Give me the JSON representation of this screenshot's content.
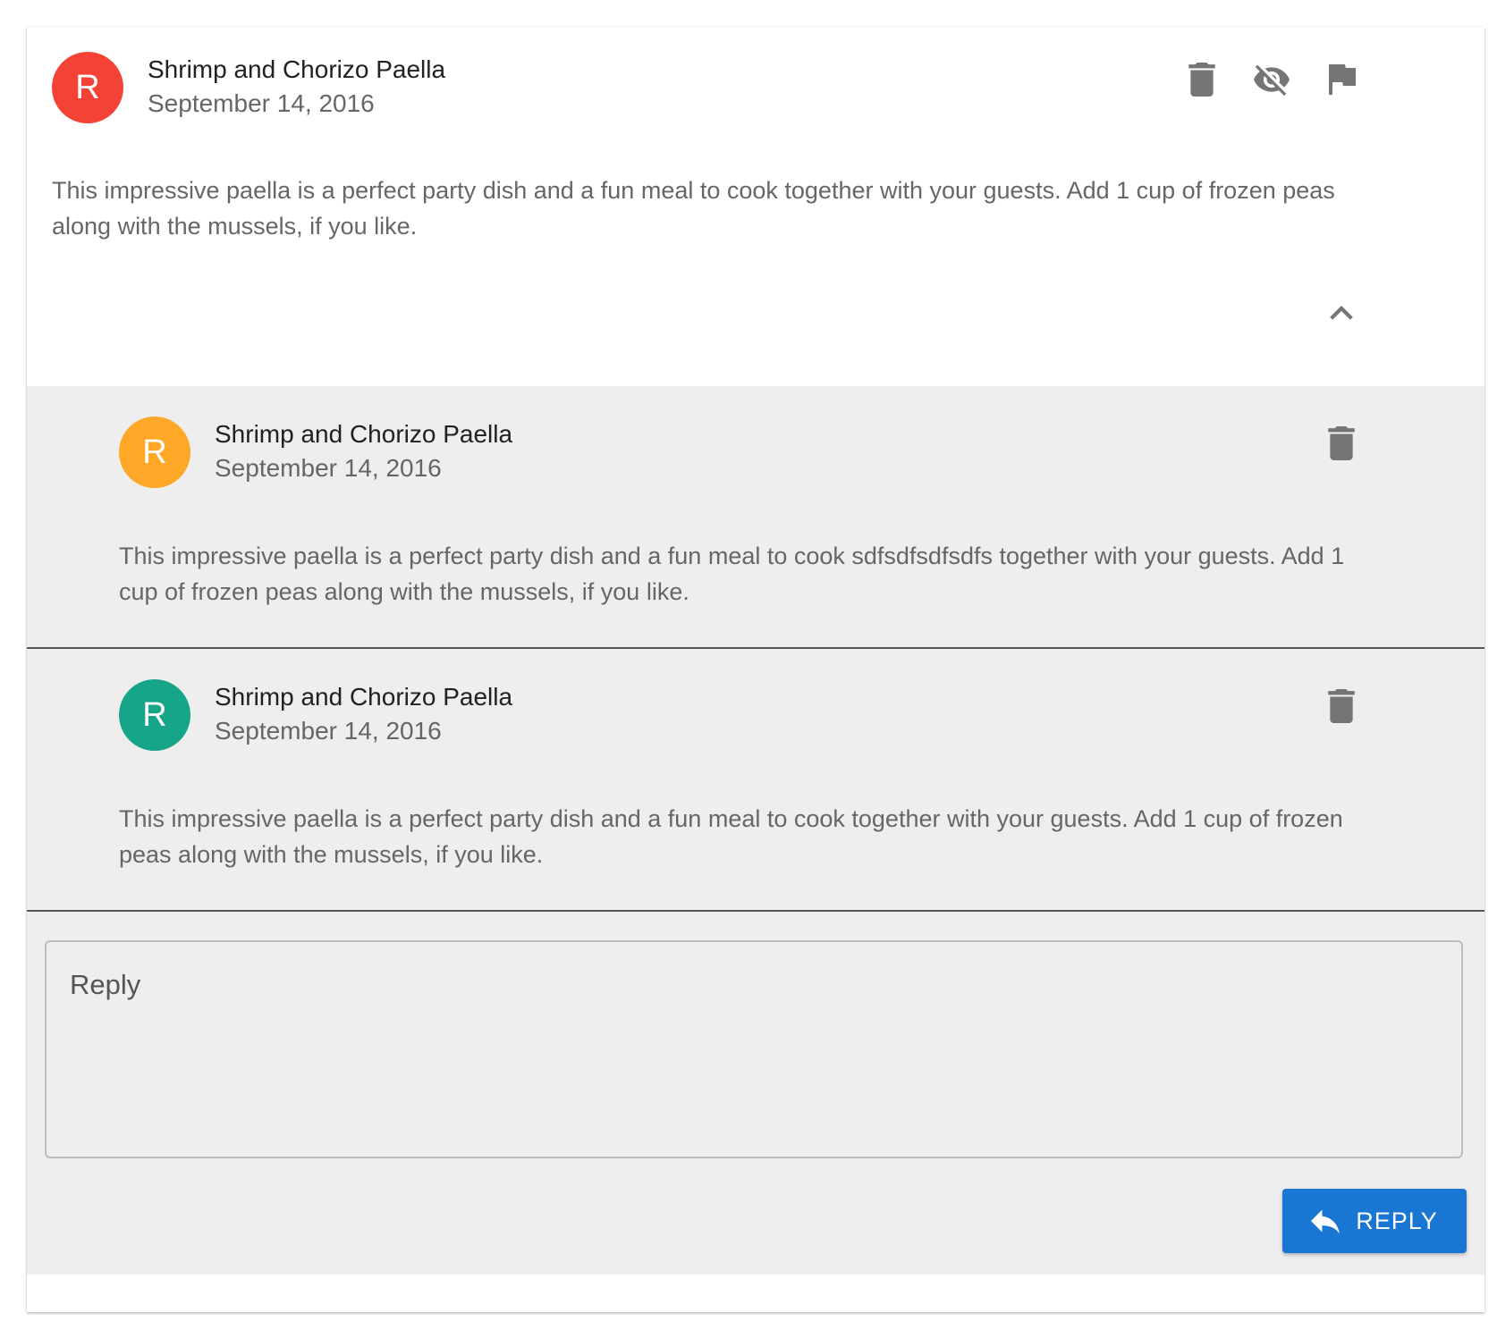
{
  "post": {
    "avatar_letter": "R",
    "avatar_color": "#f44336",
    "title": "Shrimp and Chorizo Paella",
    "date": "September 14, 2016",
    "body": "This impressive paella is a perfect party dish and a fun meal to cook together with your guests. Add 1 cup of frozen peas along with the mussels, if you like.",
    "actions": [
      "delete-icon",
      "visibility-off-icon",
      "flag-icon"
    ],
    "collapse_icon": "chevron-up-icon"
  },
  "comments": [
    {
      "avatar_letter": "R",
      "avatar_color": "#ffa726",
      "title": "Shrimp and Chorizo Paella",
      "date": "September 14, 2016",
      "body": "This impressive paella is a perfect party dish and a fun meal to cook sdfsdfsdfsdfs together with your guests. Add 1 cup of frozen peas along with the mussels, if you like."
    },
    {
      "avatar_letter": "R",
      "avatar_color": "#17a589",
      "title": "Shrimp and Chorizo Paella",
      "date": "September 14, 2016",
      "body": "This impressive paella is a perfect party dish and a fun meal to cook together with your guests. Add 1 cup of frozen peas along with the mussels, if you like."
    }
  ],
  "reply": {
    "placeholder": "Reply",
    "value": "",
    "button_label": "REPLY",
    "button_color": "#1976d2",
    "button_icon": "reply-icon"
  }
}
